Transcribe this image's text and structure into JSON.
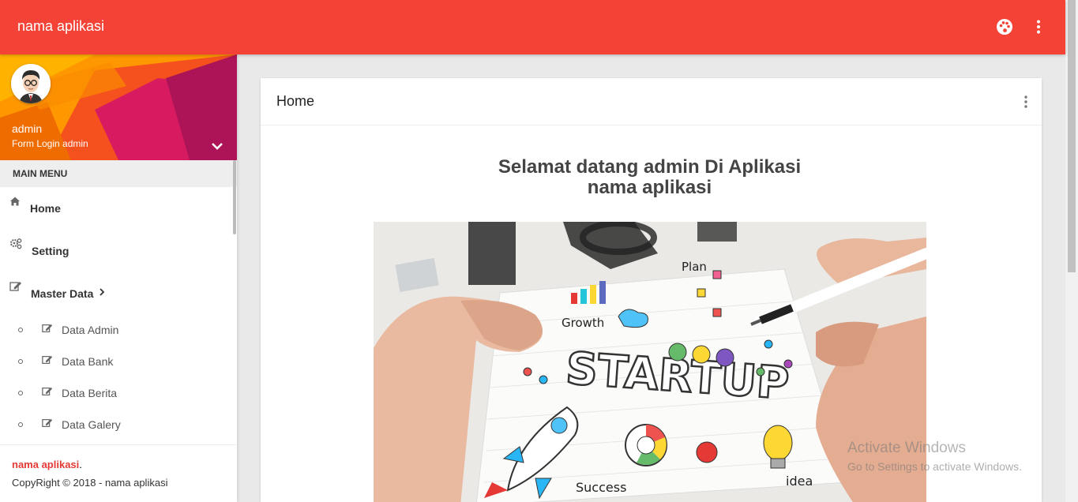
{
  "app": {
    "brand": "nama aplikasi"
  },
  "topbar": {
    "icons": [
      "palette-icon",
      "more-vert-icon"
    ]
  },
  "user": {
    "name": "admin",
    "description": "Form Login admin"
  },
  "sidebar": {
    "header": "MAIN MENU",
    "items": [
      {
        "label": "Home",
        "icon": "home-icon"
      },
      {
        "label": "Setting",
        "icon": "settings-icon"
      },
      {
        "label": "Master Data",
        "icon": "edit-icon"
      }
    ],
    "submenu": [
      {
        "label": "Data Admin",
        "icon": "edit-icon"
      },
      {
        "label": "Data Bank",
        "icon": "edit-icon"
      },
      {
        "label": "Data Berita",
        "icon": "edit-icon"
      },
      {
        "label": "Data Galery",
        "icon": "edit-icon"
      }
    ]
  },
  "legal": {
    "app_name": "nama aplikasi",
    "dot": ".",
    "copyright": "CopyRight © 2018 - nama aplikasi"
  },
  "main": {
    "card_title": "Home",
    "welcome_line1": "Selamat datang admin Di Aplikasi",
    "welcome_line2": "nama aplikasi"
  },
  "hero_image": {
    "text": "STARTUP",
    "labels": [
      "Plan",
      "Growth",
      "Success",
      "idea"
    ]
  },
  "watermark": {
    "title": "Activate Windows",
    "subtitle": "Go to Settings to activate Windows."
  },
  "colors": {
    "primary": "#f44336",
    "accent": "#e53935"
  }
}
